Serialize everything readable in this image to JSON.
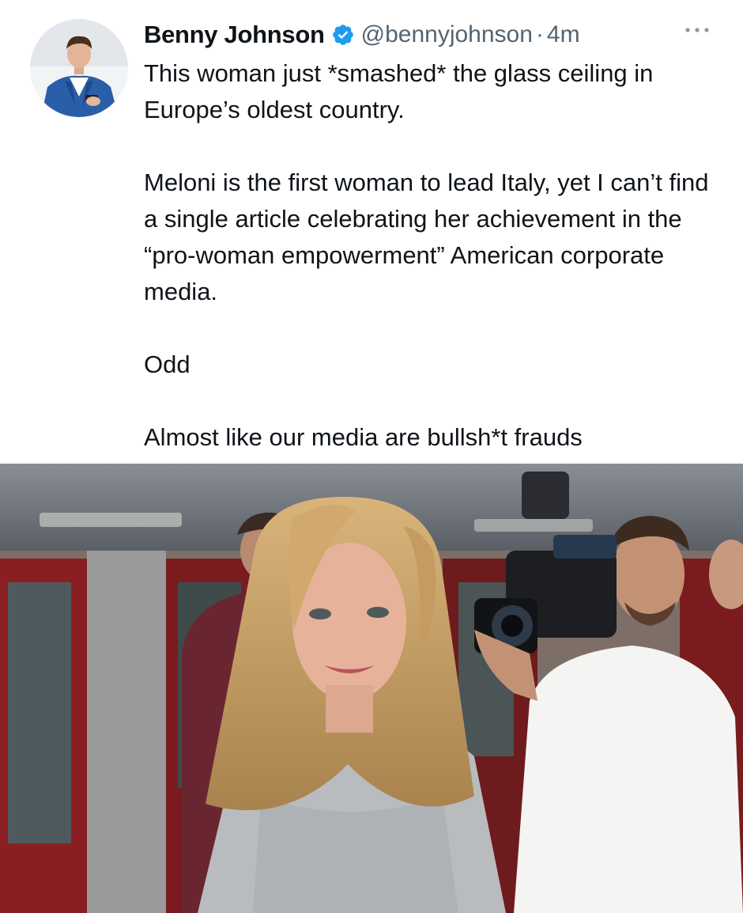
{
  "tweet": {
    "author_name": "Benny Johnson",
    "handle": "@bennyjohnson",
    "separator": "·",
    "time": "4m",
    "verified": true,
    "avatar_icon": "profile-photo-avatar",
    "more_icon": "more-dots-icon",
    "paragraphs": [
      "This woman just *smashed* the glass ceiling in Europe’s oldest country.",
      "Meloni is the first woman to lead Italy, yet I can’t find a single article celebrating her achievement in the “pro-woman empowerment” American corporate media.",
      "Odd",
      "Almost like our media are bullsh*t frauds"
    ]
  },
  "colors": {
    "text": "#0f1419",
    "secondary": "#536471",
    "verified_blue": "#1d9bf0"
  },
  "media": {
    "type": "photo",
    "icon": "attached-photo"
  }
}
